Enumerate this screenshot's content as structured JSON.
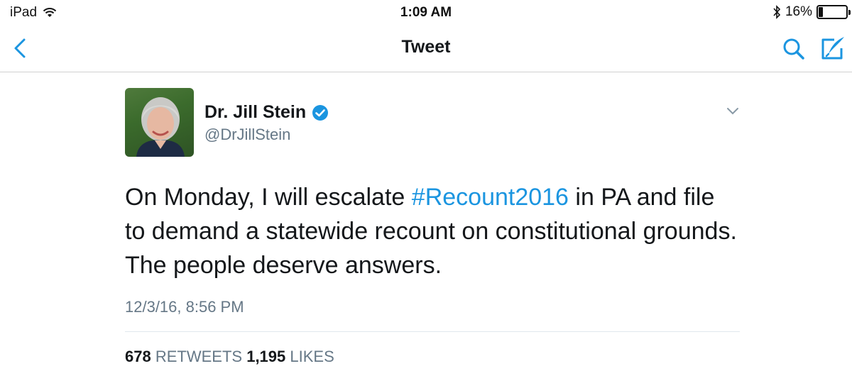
{
  "status_bar": {
    "device": "iPad",
    "time": "1:09 AM",
    "battery_percent": "16%",
    "battery_level": 0.16
  },
  "nav": {
    "title": "Tweet"
  },
  "tweet": {
    "author_name": "Dr. Jill Stein",
    "author_handle": "@DrJillStein",
    "text_before": "On Monday, I will escalate ",
    "hashtag": "#Recount2016",
    "text_after": " in PA and file to demand a statewide recount on constitutional grounds. The people deserve answers.",
    "timestamp": "12/3/16, 8:56 PM",
    "retweets_count": "678",
    "retweets_label": "RETWEETS",
    "likes_count": "1,195",
    "likes_label": "LIKES"
  },
  "colors": {
    "accent": "#1b95e0",
    "text": "#14171a",
    "muted": "#657786"
  },
  "icons": {
    "back": "chevron-left-icon",
    "search": "search-icon",
    "compose": "compose-icon",
    "verified": "verified-badge-icon",
    "caret": "chevron-down-icon",
    "wifi": "wifi-icon",
    "bluetooth": "bluetooth-icon",
    "battery": "battery-icon"
  }
}
